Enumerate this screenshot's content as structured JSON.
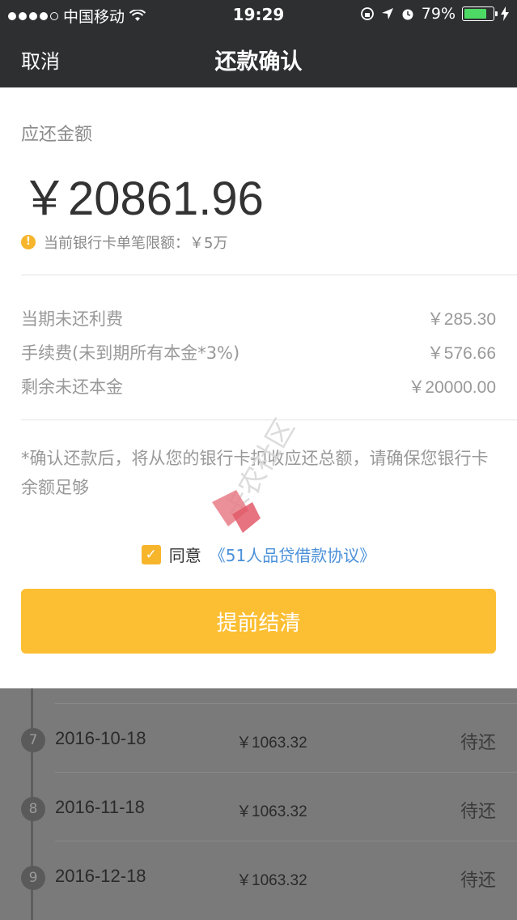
{
  "statusbar": {
    "carrier": "中国移动",
    "time": "19:29",
    "battery": "79%",
    "battery_level": 0.79
  },
  "nav": {
    "cancel": "取消",
    "title": "还款确认"
  },
  "panel": {
    "due_label": "应还金额",
    "amount": "￥20861.96",
    "limit_text": "当前银行卡单笔限额：￥5万",
    "fees": [
      {
        "label": "当期未还利费",
        "value": "￥285.30"
      },
      {
        "label": "手续费(未到期所有本金*3%)",
        "value": "￥576.66"
      },
      {
        "label": "剩余未还本金",
        "value": "￥20000.00"
      }
    ],
    "notice": "*确认还款后，将从您的银行卡扣收应还总额，请确保您银行卡余额足够",
    "agree_text": "同意",
    "agree_link": "《51人品贷借款协议》",
    "settle_button": "提前结清"
  },
  "watermark": "卡农社区",
  "schedule": [
    {
      "index": "7",
      "date": "2016-10-18",
      "amount": "￥1063.32",
      "status": "待还"
    },
    {
      "index": "8",
      "date": "2016-11-18",
      "amount": "￥1063.32",
      "status": "待还"
    },
    {
      "index": "9",
      "date": "2016-12-18",
      "amount": "￥1063.32",
      "status": "待还"
    }
  ],
  "colors": {
    "accent": "#fcbf34",
    "link": "#4a90d9",
    "header": "#2e2f31"
  }
}
